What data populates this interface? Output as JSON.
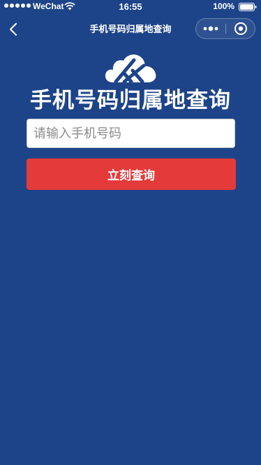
{
  "status_bar": {
    "carrier": "WeChat",
    "time": "16:55",
    "battery_percent": "100%",
    "icons": [
      "signal-dots-icon",
      "wifi-icon",
      "battery-icon"
    ]
  },
  "nav": {
    "title": "手机号码归属地查询",
    "icons": [
      "back-chevron-icon",
      "more-dots-icon",
      "close-circle-icon"
    ]
  },
  "hero": {
    "logo_icon": "cloud-logo-icon",
    "heading": "手机号码归属地查询"
  },
  "form": {
    "phone_value": "",
    "phone_placeholder": "请输入手机号码",
    "submit_label": "立刻查询"
  },
  "colors": {
    "background": "#1d4488",
    "button": "#e53a3a",
    "input_background": "#ffffff"
  }
}
